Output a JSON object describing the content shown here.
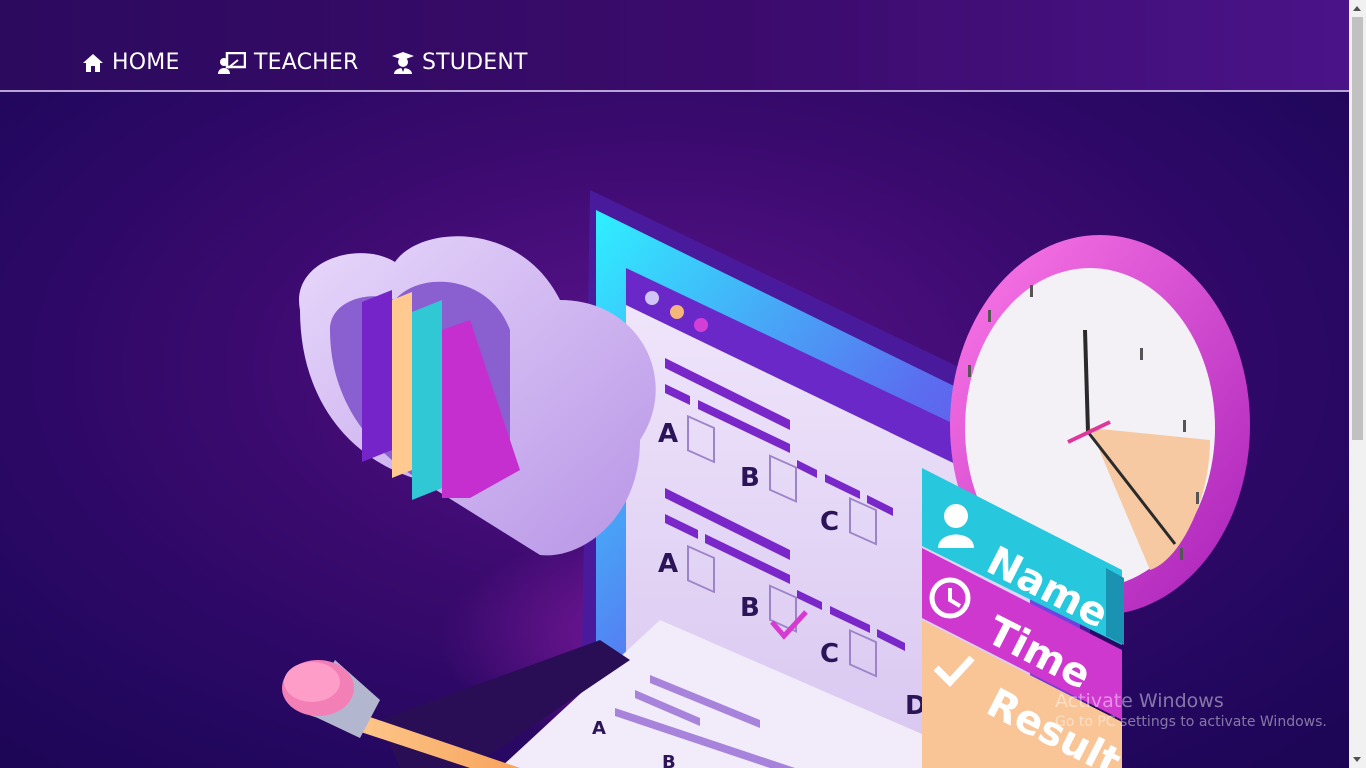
{
  "nav": {
    "items": [
      {
        "label": "HOME",
        "icon": "home-icon"
      },
      {
        "label": "TEACHER",
        "icon": "teacher-icon"
      },
      {
        "label": "STUDENT",
        "icon": "student-icon"
      }
    ]
  },
  "hero": {
    "illustration": "online-exam-illustration",
    "labels": {
      "name": "Name",
      "time": "Time",
      "result": "Result"
    },
    "options": [
      "A",
      "B",
      "C",
      "A",
      "B",
      "C",
      "D"
    ]
  },
  "watermark": {
    "title": "Activate Windows",
    "subtitle": "Go to PC settings to activate Windows."
  },
  "colors": {
    "background": "#2a0862",
    "accent_cyan": "#2fd6e8",
    "accent_magenta": "#d63ad0",
    "accent_peach": "#f7c28e",
    "screen_frame": "#6a2ad0"
  }
}
